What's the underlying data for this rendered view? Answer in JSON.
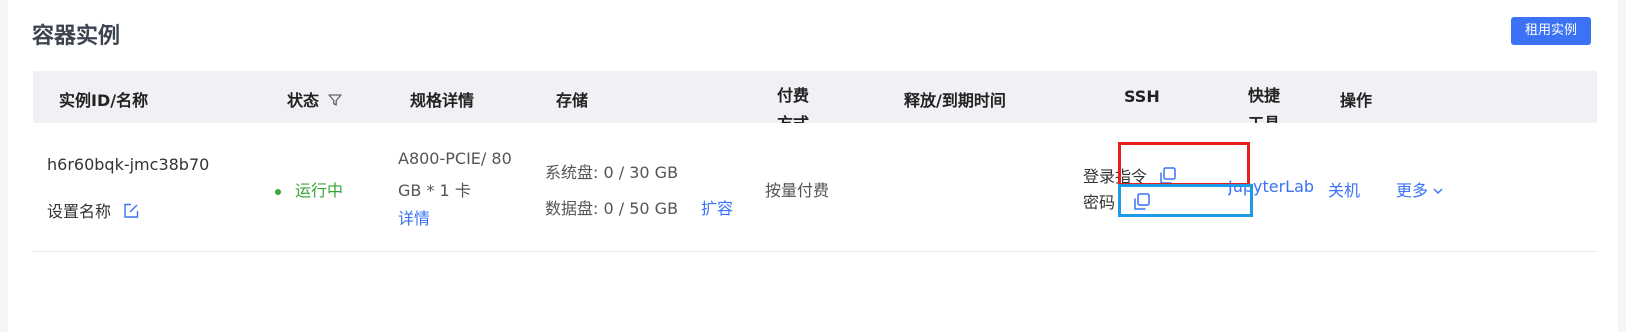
{
  "page": {
    "title": "容器实例",
    "rent_button": "租用实例"
  },
  "columns": {
    "instance": "实例ID/名称",
    "status": "状态",
    "spec": "规格详情",
    "storage": "存储",
    "payment": "付费方式",
    "release": "释放/到期时间",
    "ssh": "SSH",
    "shortcut": "快捷工具",
    "actions": "操作"
  },
  "instance": {
    "id": "h6r60bqk-jmc38b70",
    "set_name": "设置名称",
    "status": "运行中",
    "spec_line1": "A800-PCIE/ 80",
    "spec_line2": "GB * 1 卡",
    "spec_detail_link": "详情",
    "system_disk": "系统盘: 0 / 30 GB",
    "data_disk": "数据盘: 0 / 50 GB",
    "expand_link": "扩容",
    "payment": "按量付费",
    "ssh_login": "登录指令",
    "ssh_password": "密码",
    "shortcut_tool": "JupyterLab",
    "action_shutdown": "关机",
    "action_more": "更多"
  },
  "colors": {
    "accent": "#3b72f6",
    "running": "#3aa53a",
    "highlight_red": "#e41f1f",
    "highlight_blue": "#1e9be6"
  }
}
